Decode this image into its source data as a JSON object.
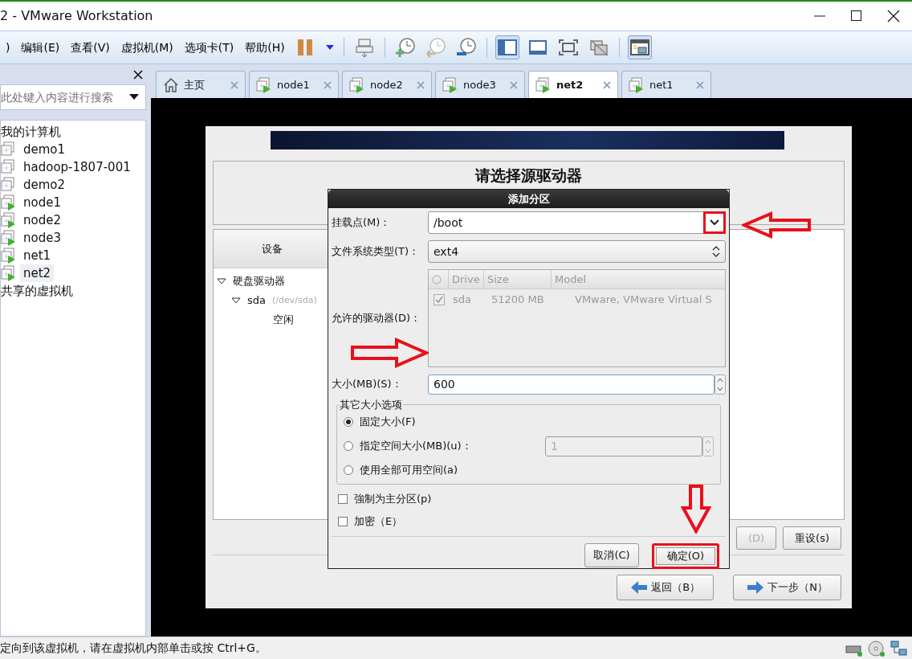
{
  "window": {
    "title": "2 - VMware Workstation"
  },
  "menu": [
    ")",
    "编辑(E)",
    "查看(V)",
    "虚拟机(M)",
    "选项卡(T)",
    "帮助(H)"
  ],
  "toolbar": [
    {
      "kind": "pause",
      "selected": false
    },
    {
      "kind": "caret",
      "selected": false
    },
    {
      "kind": "sep"
    },
    {
      "kind": "send",
      "selected": false
    },
    {
      "kind": "sep"
    },
    {
      "kind": "snapshot",
      "selected": false
    },
    {
      "kind": "revert",
      "selected": false
    },
    {
      "kind": "manage",
      "selected": false
    },
    {
      "kind": "sep"
    },
    {
      "kind": "sidebar",
      "selected": true
    },
    {
      "kind": "console",
      "selected": false
    },
    {
      "kind": "fullscreen",
      "selected": false
    },
    {
      "kind": "unity",
      "selected": false
    },
    {
      "kind": "sep"
    },
    {
      "kind": "thumbs",
      "selected": true
    }
  ],
  "sidebar": {
    "search": {
      "placeholder": "此处键入内容进行搜索"
    },
    "tree": [
      {
        "label": "我的计算机",
        "children": [
          {
            "label": "demo1",
            "running": false,
            "selected": false
          },
          {
            "label": "hadoop-1807-001",
            "running": false,
            "selected": false
          },
          {
            "label": "demo2",
            "running": false,
            "selected": false
          },
          {
            "label": "node1",
            "running": true,
            "selected": false
          },
          {
            "label": "node2",
            "running": true,
            "selected": false
          },
          {
            "label": "node3",
            "running": true,
            "selected": false
          },
          {
            "label": "net1",
            "running": true,
            "selected": false
          },
          {
            "label": "net2",
            "running": true,
            "selected": true
          }
        ]
      },
      {
        "label": "共享的虚拟机"
      }
    ]
  },
  "tabs": [
    {
      "label": "主页",
      "kind": "home",
      "selected": false
    },
    {
      "label": "node1",
      "kind": "vm",
      "selected": false
    },
    {
      "label": "node2",
      "kind": "vm",
      "selected": false
    },
    {
      "label": "node3",
      "kind": "vm",
      "selected": false
    },
    {
      "label": "net2",
      "kind": "vm",
      "selected": true
    },
    {
      "label": "net1",
      "kind": "vm",
      "selected": false
    }
  ],
  "installer": {
    "heading": "请选择源驱动器",
    "column": "设备",
    "tree": [
      {
        "label": "硬盘驱动器",
        "expanded": true,
        "children": [
          {
            "label": "sda",
            "detail": "(/dev/sda)",
            "expanded": true,
            "children": [
              {
                "label": "空闲"
              }
            ]
          }
        ]
      }
    ],
    "buttons": [
      "(D)",
      "重设(s)"
    ],
    "nav": [
      {
        "label": "返回（B）",
        "kind": "back"
      },
      {
        "label": "下一步（N）",
        "kind": "next"
      }
    ]
  },
  "dialog": {
    "title": "添加分区",
    "mount": {
      "label": "挂载点(M)：",
      "value": "/boot",
      "marked": true
    },
    "fs": {
      "label": "文件系统类型(T)：",
      "value": "ext4"
    },
    "drives": {
      "label": "允许的驱动器(D)：",
      "columns": [
        "Drive",
        "Size",
        "Model"
      ],
      "rows": [
        {
          "checked": true,
          "drive": "sda",
          "size": "51200 MB",
          "model": "VMware, VMware Virtual S"
        }
      ]
    },
    "size": {
      "label": "大小(MB)(S)：",
      "value": "600"
    },
    "options": {
      "legend": "其它大小选项",
      "items": [
        {
          "label": "固定大小(F)",
          "selected": true
        },
        {
          "label": "指定空间大小(MB)(u)：",
          "selected": false,
          "value": "1",
          "disabled": true
        },
        {
          "label": "使用全部可用空间(a)",
          "selected": false
        }
      ]
    },
    "checks": [
      {
        "label": "強制为主分区(p)",
        "checked": false
      },
      {
        "label": "加密（E）",
        "checked": false
      }
    ],
    "buttons": [
      {
        "label": "取消(C)",
        "marked": false
      },
      {
        "label": "确定(O)",
        "marked": true
      }
    ]
  },
  "status": {
    "text": "定向到该虚拟机，请在虚拟机内部单击或按 Ctrl+G。"
  }
}
